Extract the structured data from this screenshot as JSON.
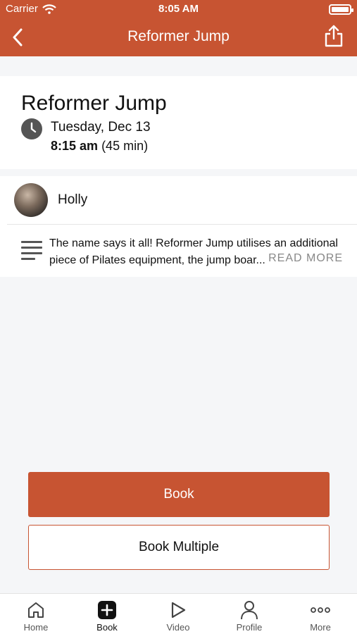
{
  "status_bar": {
    "carrier": "Carrier",
    "time": "8:05 AM"
  },
  "navbar": {
    "title": "Reformer Jump"
  },
  "class": {
    "title": "Reformer Jump",
    "date": "Tuesday, Dec 13",
    "start_time": "8:15 am",
    "duration": "(45 min)"
  },
  "instructor": {
    "name": "Holly"
  },
  "description": {
    "text": "The name says it all! Reformer Jump utilises an additional piece of Pilates equipment, the jump boar...",
    "read_more": "READ MORE"
  },
  "actions": {
    "book_label": "Book",
    "book_multiple_label": "Book Multiple"
  },
  "tabbar": {
    "items": [
      {
        "label": "Home",
        "icon": "home-icon"
      },
      {
        "label": "Book",
        "icon": "plus-square-icon"
      },
      {
        "label": "Video",
        "icon": "play-icon"
      },
      {
        "label": "Profile",
        "icon": "person-icon"
      },
      {
        "label": "More",
        "icon": "more-icon"
      }
    ]
  },
  "colors": {
    "brand": "#c75432"
  }
}
